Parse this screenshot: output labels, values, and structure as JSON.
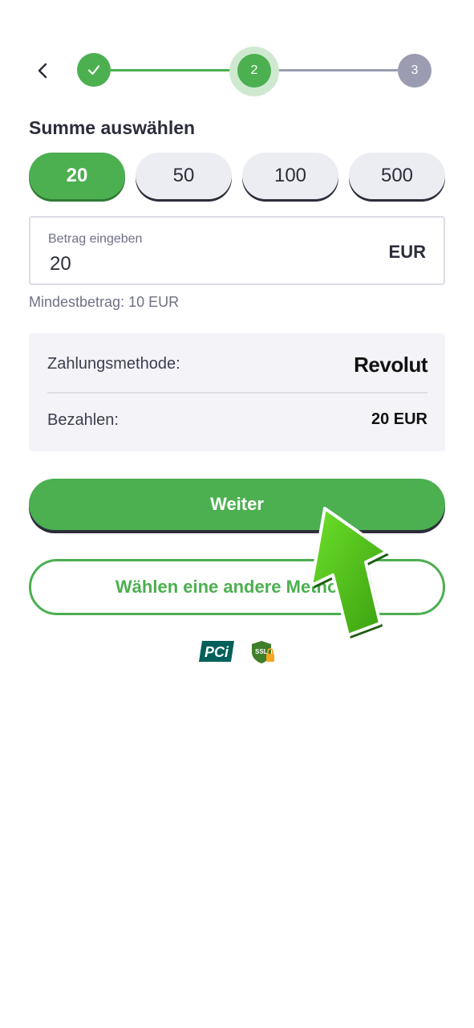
{
  "stepper": {
    "steps": [
      {
        "label": "",
        "state": "done"
      },
      {
        "label": "2",
        "state": "current"
      },
      {
        "label": "3",
        "state": "upcoming"
      }
    ],
    "colors": {
      "active": "#4caf50",
      "inactive": "#9b9bb1"
    }
  },
  "title": "Summe auswählen",
  "amounts": [
    "20",
    "50",
    "100",
    "500"
  ],
  "selected_amount": "20",
  "amount_input": {
    "label": "Betrag eingeben",
    "value": "20",
    "currency": "EUR"
  },
  "min_note": "Mindestbetrag: 10 EUR",
  "summary": {
    "method_label": "Zahlungsmethode:",
    "method_value": "Revolut",
    "pay_label": "Bezahlen:",
    "pay_value": "20 EUR"
  },
  "buttons": {
    "continue": "Weiter",
    "other_method": "Wählen eine andere Methode"
  },
  "badges": {
    "pci": "PCi",
    "ssl": "SSL"
  }
}
